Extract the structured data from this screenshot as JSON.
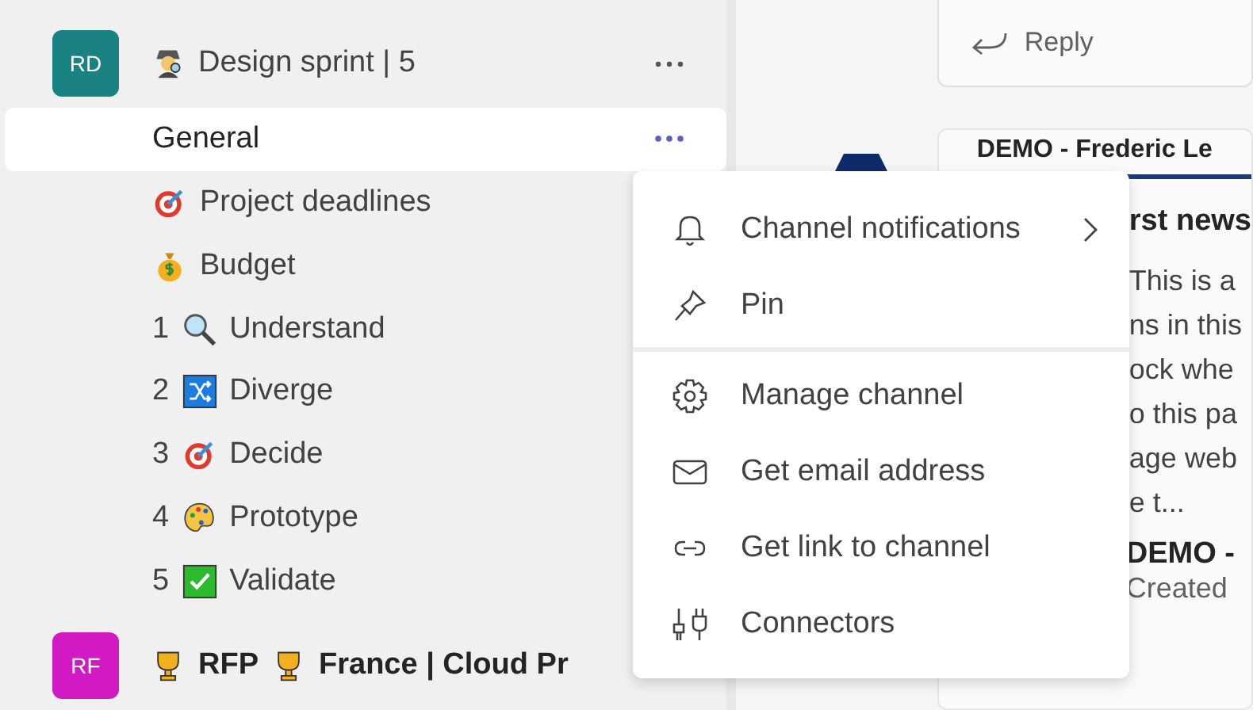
{
  "sidebar": {
    "team": {
      "initials": "RD",
      "name": "Design sprint | 5"
    },
    "channels": [
      {
        "label": "General",
        "selected": true
      },
      {
        "label": "Project deadlines",
        "selected": false
      },
      {
        "label": "Budget",
        "selected": false
      },
      {
        "number": "1",
        "label": "Understand",
        "selected": false
      },
      {
        "number": "2",
        "label": "Diverge",
        "selected": false
      },
      {
        "number": "3",
        "label": "Decide",
        "selected": false
      },
      {
        "number": "4",
        "label": "Prototype",
        "selected": false
      },
      {
        "number": "5",
        "label": "Validate",
        "selected": false
      }
    ],
    "next_team": {
      "initials": "RF",
      "name_part_1": "RFP",
      "name_part_2": "France | Cloud Pr"
    }
  },
  "feed": {
    "reply": "Reply",
    "post": {
      "header": "DEMO - Frederic Le",
      "title": "rst news",
      "lines": [
        "This is a",
        "ns in this",
        "ock whe",
        "o this pa",
        "age web",
        "e t..."
      ]
    },
    "next_post": {
      "author": "DEMO -",
      "meta": "Created"
    }
  },
  "context_menu": {
    "items": [
      {
        "kind": "bell",
        "label": "Channel notifications",
        "submenu": true
      },
      {
        "kind": "pin",
        "label": "Pin",
        "submenu": false
      },
      {
        "kind": "divider"
      },
      {
        "kind": "gear",
        "label": "Manage channel",
        "submenu": false
      },
      {
        "kind": "mail",
        "label": "Get email address",
        "submenu": false
      },
      {
        "kind": "link",
        "label": "Get link to channel",
        "submenu": false
      },
      {
        "kind": "plug",
        "label": "Connectors",
        "submenu": false
      }
    ]
  }
}
